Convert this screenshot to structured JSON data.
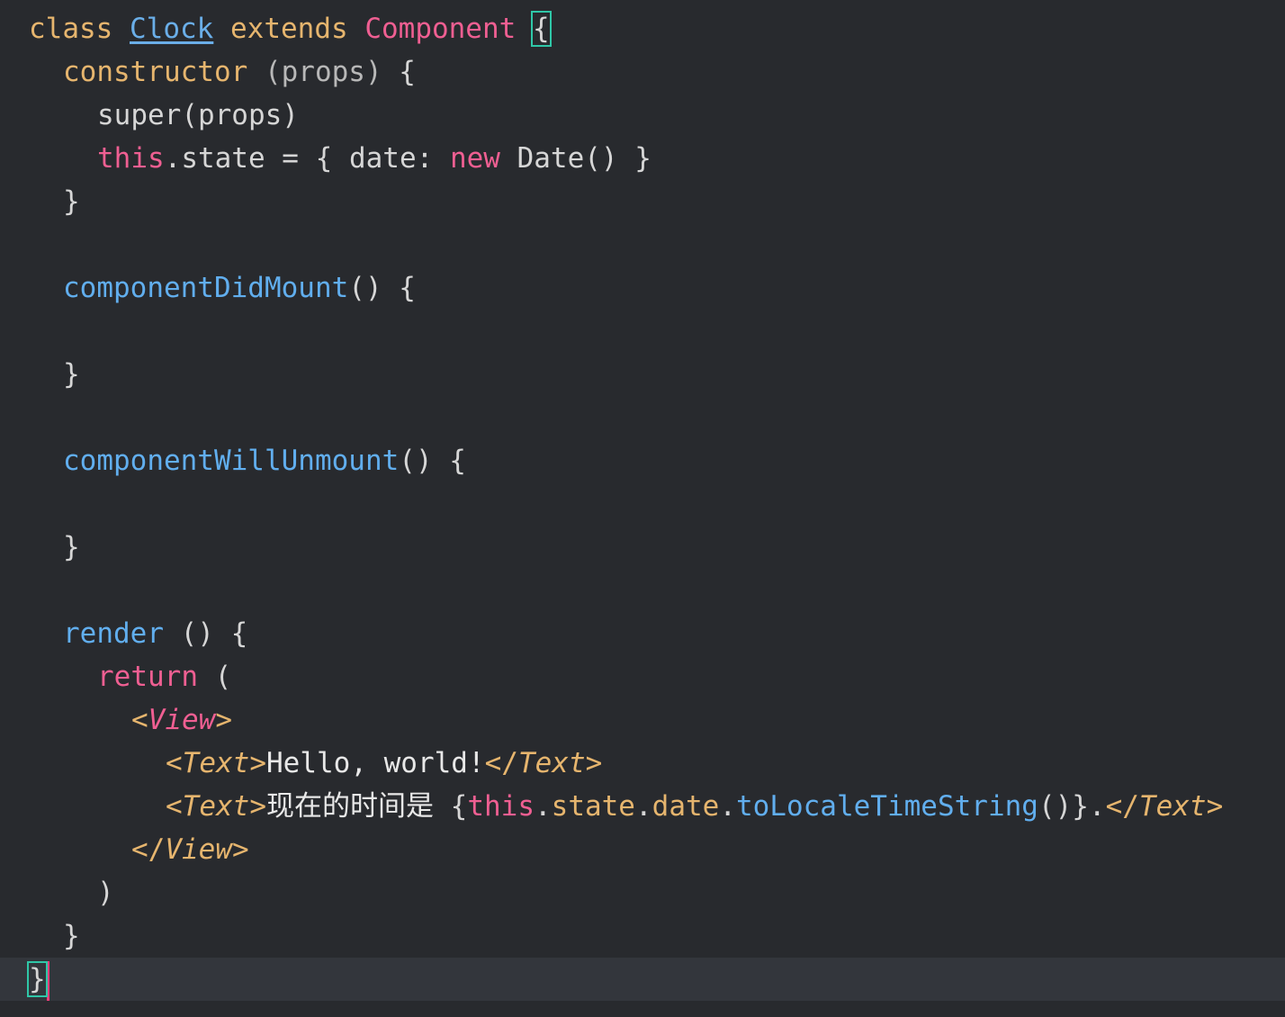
{
  "code": {
    "l1": {
      "kw_class": "class",
      "class_name": "Clock",
      "kw_extends": "extends",
      "base": "Component",
      "open": "{"
    },
    "l2": {
      "ctor": "constructor",
      "params": "(props)",
      "open": " {"
    },
    "l3": {
      "text": "super(props)"
    },
    "l4": {
      "this": "this",
      "rest1": ".state = { date: ",
      "kw_new": "new",
      "rest2": " Date() }"
    },
    "l5": {
      "close": "}"
    },
    "l7": {
      "fn": "componentDidMount",
      "rest": "() {"
    },
    "l9": {
      "close": "}"
    },
    "l11": {
      "fn": "componentWillUnmount",
      "rest": "() {"
    },
    "l13": {
      "close": "}"
    },
    "l15": {
      "fn": "render",
      "rest": " () {"
    },
    "l16": {
      "kw": "return",
      "rest": " ("
    },
    "l17": {
      "lt": "<",
      "tag": "View",
      "gt": ">"
    },
    "l18": {
      "lt": "<",
      "tag": "Text",
      "gt": ">",
      "content": "Hello, world!",
      "close_lt": "</",
      "close_tag": "Text",
      "close_gt": ">"
    },
    "l19": {
      "lt": "<",
      "tag": "Text",
      "gt": ">",
      "content_cn": "现在的时间是",
      "brace_open": " {",
      "this": "this",
      "dot1": ".",
      "state": "state",
      "dot2": ".",
      "date": "date",
      "dot3": ".",
      "method": "toLocaleTimeString",
      "call": "()",
      "brace_close": "}.",
      "close_lt": "</",
      "close_tag": "Text",
      "close_gt": ">"
    },
    "l20": {
      "lt": "</",
      "tag": "View",
      "gt": ">"
    },
    "l21": {
      "close": ")"
    },
    "l22": {
      "close": "}"
    },
    "l23": {
      "close": "}"
    }
  }
}
